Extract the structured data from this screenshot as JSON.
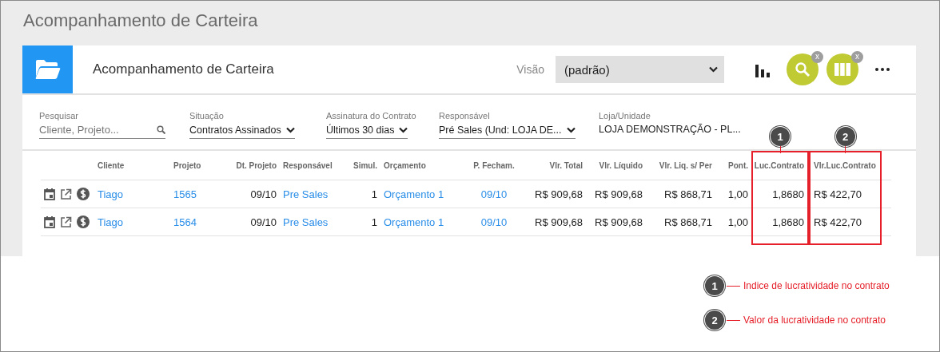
{
  "page_title": "Acompanhamento de Carteira",
  "card": {
    "title": "Acompanhamento de Carteira",
    "view_label": "Visão",
    "view_value": "(padrão)",
    "actions": [
      {
        "kind": "chart"
      },
      {
        "kind": "search",
        "badge": "x"
      },
      {
        "kind": "columns",
        "badge": "x"
      },
      {
        "kind": "more"
      }
    ]
  },
  "filters": [
    {
      "kind": "search",
      "label": "Pesquisar",
      "placeholder": "Cliente, Projeto..."
    },
    {
      "kind": "select",
      "label": "Situação",
      "value": "Contratos Assinados"
    },
    {
      "kind": "select",
      "label": "Assinatura do Contrato",
      "value": "Últimos 30 dias"
    },
    {
      "kind": "select",
      "label": "Responsável",
      "value": "Pré Sales (Und: LOJA DE..."
    },
    {
      "kind": "text",
      "label": "Loja/Unidade",
      "value": "LOJA DEMONSTRAÇÃO - PL..."
    }
  ],
  "table": {
    "columns": [
      {
        "label": "Cliente"
      },
      {
        "label": "Projeto"
      },
      {
        "label": "Dt. Projeto"
      },
      {
        "label": "Responsável"
      },
      {
        "label": "Simul."
      },
      {
        "label": "Orçamento"
      },
      {
        "label": "P. Fecham."
      },
      {
        "label": "Vlr. Total"
      },
      {
        "label": "Vlr. Líquido"
      },
      {
        "label": "Vlr. Liq. s/ Per"
      },
      {
        "label": "Pont."
      },
      {
        "label": "Luc.Contrato",
        "callout": "1"
      },
      {
        "label": "Vlr.Luc.Contrato",
        "callout": "2"
      }
    ],
    "rows": [
      {
        "cells": [
          {
            "text": "Tiago",
            "kind": "link"
          },
          {
            "text": "1565",
            "kind": "link"
          },
          {
            "text": "09/10",
            "kind": "text"
          },
          {
            "text": "Pre Sales",
            "kind": "link"
          },
          {
            "text": "1",
            "kind": "text"
          },
          {
            "text": "Orçamento 1",
            "kind": "link"
          },
          {
            "text": "09/10",
            "kind": "link"
          },
          {
            "text": "R$ 909,68",
            "kind": "text"
          },
          {
            "text": "R$ 909,68",
            "kind": "text"
          },
          {
            "text": "R$ 868,71",
            "kind": "text"
          },
          {
            "text": "1,00",
            "kind": "text"
          },
          {
            "text": "1,8680",
            "kind": "text"
          },
          {
            "text": "R$ 422,70",
            "kind": "text"
          }
        ]
      },
      {
        "cells": [
          {
            "text": "Tiago",
            "kind": "link"
          },
          {
            "text": "1564",
            "kind": "link"
          },
          {
            "text": "09/10",
            "kind": "text"
          },
          {
            "text": "Pre Sales",
            "kind": "link"
          },
          {
            "text": "1",
            "kind": "text"
          },
          {
            "text": "Orçamento 1",
            "kind": "link"
          },
          {
            "text": "09/10",
            "kind": "link"
          },
          {
            "text": "R$ 909,68",
            "kind": "text"
          },
          {
            "text": "R$ 909,68",
            "kind": "text"
          },
          {
            "text": "R$ 868,71",
            "kind": "text"
          },
          {
            "text": "1,00",
            "kind": "text"
          },
          {
            "text": "1,8680",
            "kind": "text"
          },
          {
            "text": "R$ 422,70",
            "kind": "text"
          }
        ]
      }
    ]
  },
  "legend": [
    {
      "number": "1",
      "text": "Indice de lucratividade no contrato"
    },
    {
      "number": "2",
      "text": "Valor da lucratividade no contrato"
    }
  ]
}
